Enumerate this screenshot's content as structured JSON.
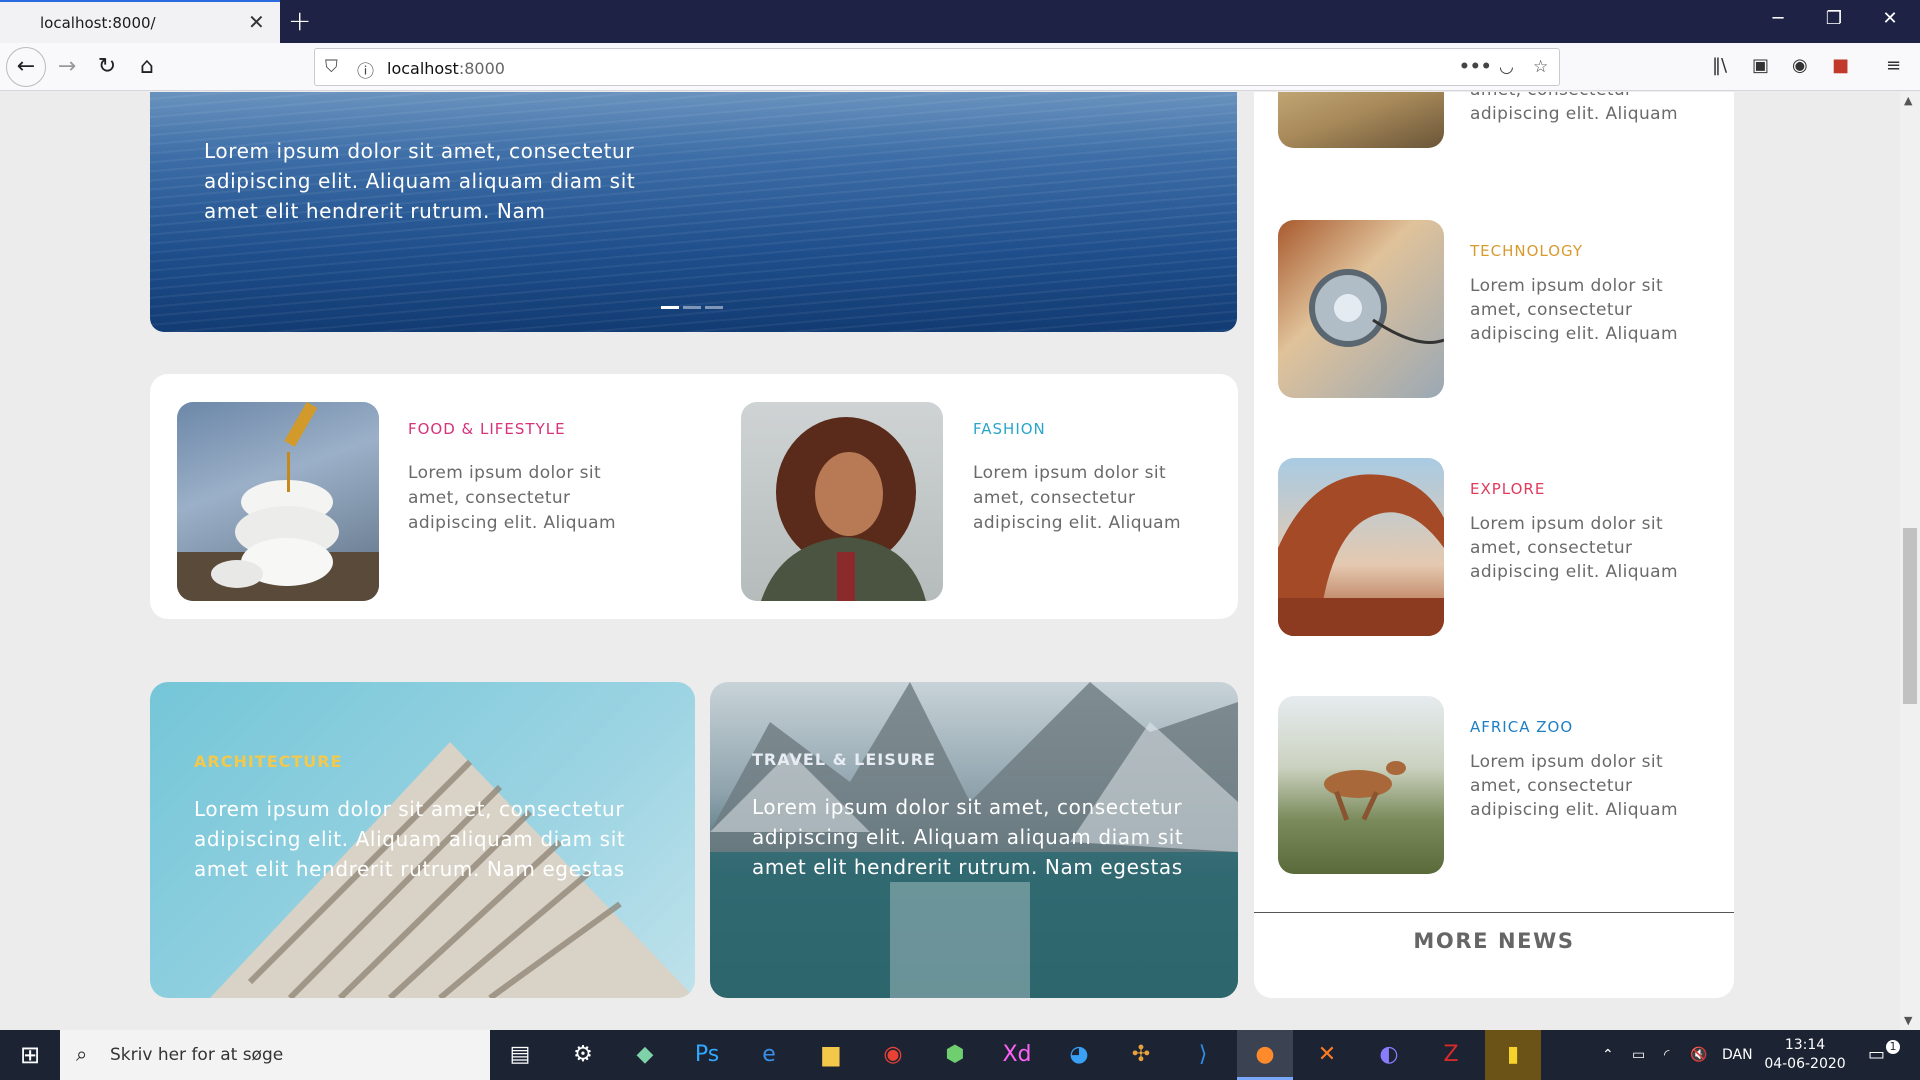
{
  "browser": {
    "tab_title": "localhost:8000/",
    "tab_close": "✕",
    "new_tab": "+",
    "url_host": "localhost",
    "url_port": ":8000",
    "window_controls": [
      "─",
      "❐",
      "✕"
    ]
  },
  "hero": {
    "text": "Lorem ipsum dolor sit amet, consectetur adipiscing elit. Aliquam aliquam diam sit amet elit hendrerit rutrum. Nam",
    "slide_count": 3,
    "active_slide": 1
  },
  "cards": [
    {
      "category": "FOOD & LIFESTYLE",
      "color": "#d6337a",
      "body": "Lorem ipsum dolor sit amet, consectetur adipiscing elit. Aliquam",
      "image": "honey-jar"
    },
    {
      "category": "FASHION",
      "color": "#2aa6c9",
      "body": "Lorem ipsum dolor sit amet, consectetur adipiscing elit. Aliquam",
      "image": "woman-portrait"
    }
  ],
  "big_cards": [
    {
      "category": "ARCHITECTURE",
      "color": "#f2c94c",
      "body": "Lorem ipsum dolor sit amet, consectetur adipiscing elit. Aliquam aliquam diam sit amet elit hendrerit rutrum. Nam egestas",
      "image": "building"
    },
    {
      "category": "TRAVEL & LEISURE",
      "color": "#e8ecf3",
      "body": "Lorem ipsum dolor sit amet, consectetur adipiscing elit. Aliquam aliquam diam sit amet elit hendrerit rutrum. Nam egestas",
      "image": "mountain-lake"
    }
  ],
  "sidebar": {
    "partial_body": "amet, consectetur adipiscing elit. Aliquam",
    "items": [
      {
        "category": "TECHNOLOGY",
        "color": "#d89a2f",
        "body": "Lorem ipsum dolor sit amet, consectetur adipiscing elit. Aliquam",
        "image": "headphones"
      },
      {
        "category": "EXPLORE",
        "color": "#e23a5d",
        "body": "Lorem ipsum dolor sit amet, consectetur adipiscing elit. Aliquam",
        "image": "arch"
      },
      {
        "category": "AFRICA ZOO",
        "color": "#1f7fc4",
        "body": "Lorem ipsum dolor sit amet, consectetur adipiscing elit. Aliquam",
        "image": "antelope"
      }
    ],
    "more_news": "MORE NEWS"
  },
  "taskbar": {
    "search_placeholder": "Skriv her for at søge",
    "language": "DAN",
    "time": "13:14",
    "date": "04-06-2020",
    "notification_count": "1"
  }
}
